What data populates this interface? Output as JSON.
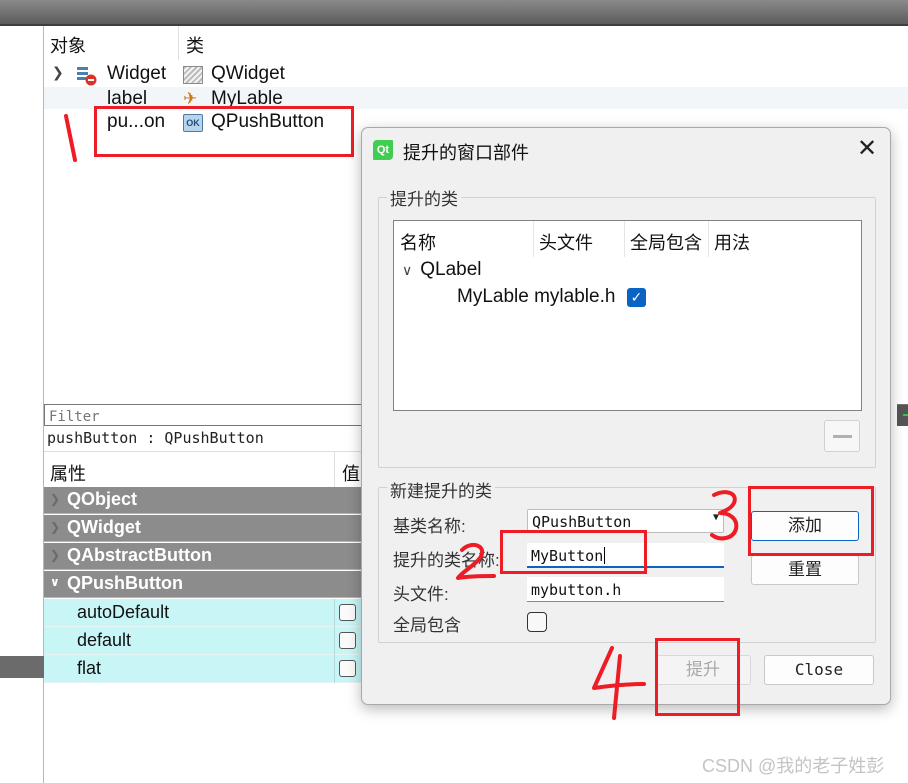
{
  "object_inspector": {
    "col_object": "对象",
    "col_class": "类",
    "rows": [
      {
        "name": "Widget",
        "class": "QWidget"
      },
      {
        "name": "label",
        "class": "MyLable"
      },
      {
        "name": "pu...on",
        "class": "QPushButton"
      }
    ]
  },
  "property_editor": {
    "filter_placeholder": "Filter",
    "selection": "pushButton : QPushButton",
    "col_property": "属性",
    "col_value": "值",
    "groups": [
      "QObject",
      "QWidget",
      "QAbstractButton",
      "QPushButton"
    ],
    "properties": [
      "autoDefault",
      "default",
      "flat"
    ]
  },
  "dialog": {
    "title": "提升的窗口部件",
    "promoted_group_title": "提升的类",
    "list_headers": [
      "名称",
      "头文件",
      "全局包含",
      "用法"
    ],
    "base_class": "QLabel",
    "promoted_entry_name": "MyLable",
    "promoted_entry_header": "mylable.h",
    "promoted_entry_global": true,
    "new_group_title": "新建提升的类",
    "base_class_label": "基类名称:",
    "base_class_value": "QPushButton",
    "promoted_name_label": "提升的类名称:",
    "promoted_name_value": "MyButton",
    "header_label": "头文件:",
    "header_value": "mybutton.h",
    "global_include_label": "全局包含",
    "global_include_checked": false,
    "add_button": "添加",
    "reset_button": "重置",
    "promote_button": "提升",
    "close_button": "Close"
  },
  "annotations": [
    "1",
    "2",
    "3",
    "4"
  ],
  "watermark": "CSDN @我的老子姓彭",
  "colors": {
    "annotation_red": "#ee1c24",
    "accent_blue": "#0a64c4",
    "property_row": "#c8f6f6",
    "group_header": "#8c8c8c",
    "qt_green": "#41cd52"
  },
  "icons": [
    "widget-tree-icon",
    "widget-class-icon",
    "label-class-icon",
    "pushbutton-class-icon",
    "qt-logo-icon",
    "close-icon",
    "chevron-down-icon",
    "checkmark-icon",
    "minus-icon",
    "dropdown-arrow-icon"
  ]
}
